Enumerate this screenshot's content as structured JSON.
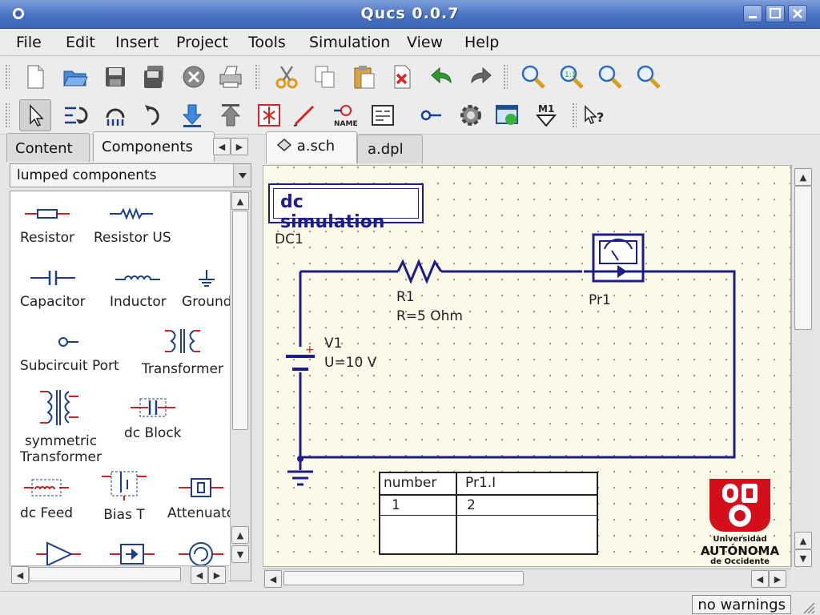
{
  "window": {
    "title": "Qucs 0.0.7"
  },
  "menu": {
    "items": [
      "File",
      "Edit",
      "Insert",
      "Project",
      "Tools",
      "Simulation",
      "View",
      "Help"
    ]
  },
  "left_panel": {
    "tabs": [
      "Content",
      "Components"
    ],
    "category": "lumped components",
    "components": [
      "Resistor",
      "Resistor US",
      "Capacitor",
      "Inductor",
      "Ground",
      "Subcircuit Port",
      "Transformer",
      "symmetric",
      "Transformer",
      "dc Block",
      "dc Feed",
      "Bias T",
      "Attenuator"
    ]
  },
  "doc_tabs": [
    "a.sch",
    "a.dpl"
  ],
  "schematic": {
    "sim_box": "dc simulation",
    "sim_name": "DC1",
    "r1_name": "R1",
    "r1_value": "R=5 Ohm",
    "v1_name": "V1",
    "v1_value": "U=10 V",
    "probe_name": "Pr1",
    "table": {
      "headers": [
        "number",
        "Pr1.I"
      ],
      "rows": [
        [
          "1",
          "2"
        ]
      ]
    }
  },
  "logo": {
    "line1": "Universidad",
    "line2": "AUTÓNOMA",
    "line3": "de Occidente",
    "color": "#d40f1c"
  },
  "status": {
    "warnings": "no warnings"
  },
  "colors": {
    "wire": "#1c1c8c",
    "titlebar": "#4a72c2",
    "canvas": "#fbf9e8"
  }
}
